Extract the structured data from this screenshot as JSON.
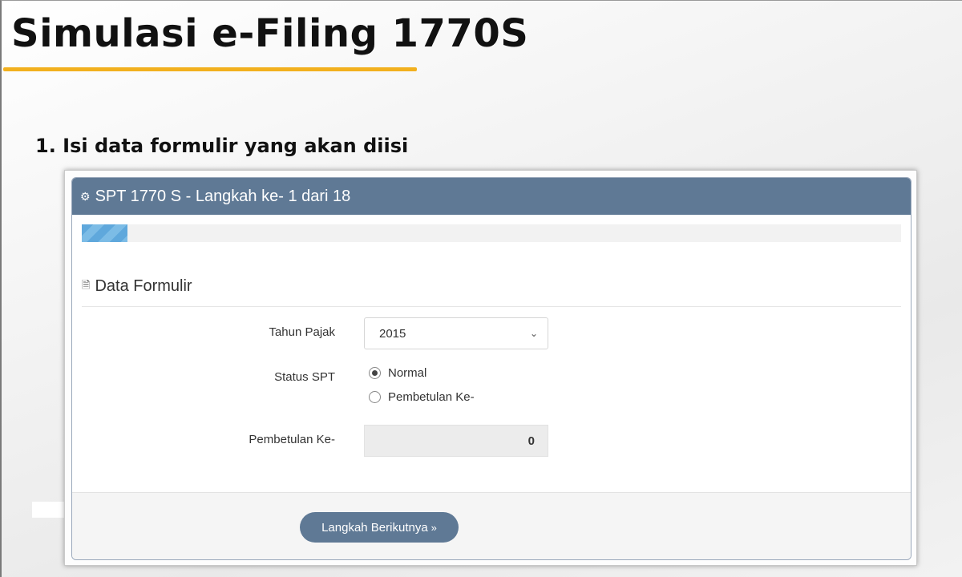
{
  "slide": {
    "title": "Simulasi e-Filing 1770S",
    "step_heading": "1. Isi data formulir yang akan diisi"
  },
  "panel": {
    "header_icon": "gear-icon",
    "header_title": "SPT 1770 S - Langkah ke- 1 dari 18",
    "progress": {
      "current_step": 1,
      "total_steps": 18
    }
  },
  "section": {
    "icon": "document-icon",
    "title": "Data Formulir"
  },
  "form": {
    "tahun_pajak": {
      "label": "Tahun Pajak",
      "value": "2015"
    },
    "status_spt": {
      "label": "Status SPT",
      "options": [
        {
          "label": "Normal",
          "checked": true
        },
        {
          "label": "Pembetulan Ke-",
          "checked": false
        }
      ]
    },
    "pembetulan_ke": {
      "label": "Pembetulan Ke-",
      "value": "0"
    }
  },
  "footer": {
    "next_button_label": "Langkah Berikutnya",
    "next_button_icon": "double-chevron-right-icon"
  },
  "colors": {
    "header_bg": "#5f7995",
    "accent_underline": "#f2b01e",
    "progress_fill": "#5fa8dc"
  }
}
